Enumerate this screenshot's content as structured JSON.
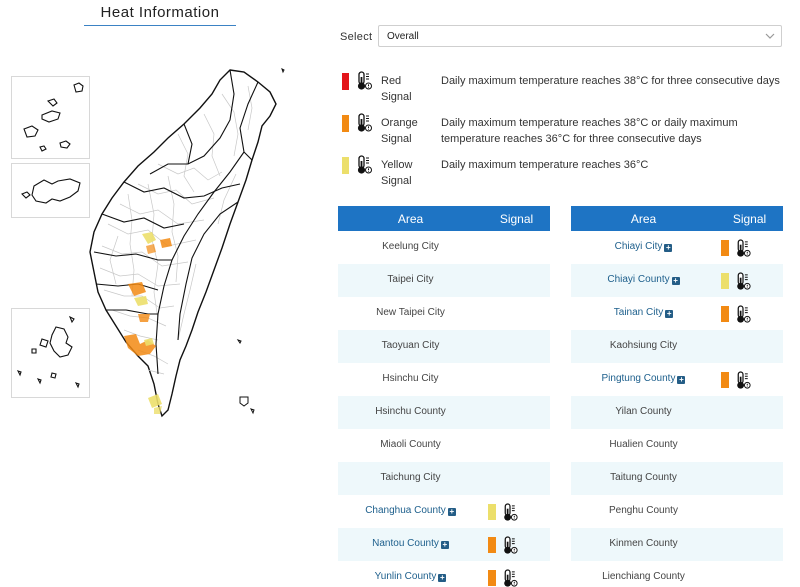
{
  "header": {
    "title": "Heat Information"
  },
  "select": {
    "label": "Select",
    "value": "Overall"
  },
  "colors": {
    "red": "#e3151a",
    "orange": "#f28a13",
    "yellow": "#ecdf6b",
    "table_header": "#1e74c4",
    "row_alt": "#eef8fb",
    "link": "#1d5f8c"
  },
  "legend": [
    {
      "level": "red",
      "name": "Red Signal",
      "description": "Daily maximum temperature reaches 38°C for three consecutive days",
      "icon": "thermometer-warning-icon"
    },
    {
      "level": "orange",
      "name": "Orange Signal",
      "description": "Daily maximum temperature reaches 38°C or daily maximum temperature reaches 36°C for three consecutive days",
      "icon": "thermometer-warning-icon"
    },
    {
      "level": "yellow",
      "name": "Yellow Signal",
      "description": "Daily maximum temperature reaches 36°C",
      "icon": "thermometer-warning-icon"
    }
  ],
  "table_headers": {
    "area": "Area",
    "signal": "Signal"
  },
  "areas_left": [
    {
      "name": "Keelung City",
      "signal": null
    },
    {
      "name": "Taipei City",
      "signal": null
    },
    {
      "name": "New Taipei City",
      "signal": null
    },
    {
      "name": "Taoyuan City",
      "signal": null
    },
    {
      "name": "Hsinchu City",
      "signal": null
    },
    {
      "name": "Hsinchu County",
      "signal": null
    },
    {
      "name": "Miaoli County",
      "signal": null
    },
    {
      "name": "Taichung City",
      "signal": null
    },
    {
      "name": "Changhua County",
      "signal": "yellow"
    },
    {
      "name": "Nantou County",
      "signal": "orange"
    },
    {
      "name": "Yunlin County",
      "signal": "orange"
    }
  ],
  "areas_right": [
    {
      "name": "Chiayi City",
      "signal": "orange"
    },
    {
      "name": "Chiayi County",
      "signal": "yellow"
    },
    {
      "name": "Tainan City",
      "signal": "orange"
    },
    {
      "name": "Kaohsiung City",
      "signal": null
    },
    {
      "name": "Pingtung County",
      "signal": "orange"
    },
    {
      "name": "Yilan County",
      "signal": null
    },
    {
      "name": "Hualien County",
      "signal": null
    },
    {
      "name": "Taitung County",
      "signal": null
    },
    {
      "name": "Penghu County",
      "signal": null
    },
    {
      "name": "Kinmen County",
      "signal": null
    },
    {
      "name": "Lienchiang County",
      "signal": null
    }
  ]
}
